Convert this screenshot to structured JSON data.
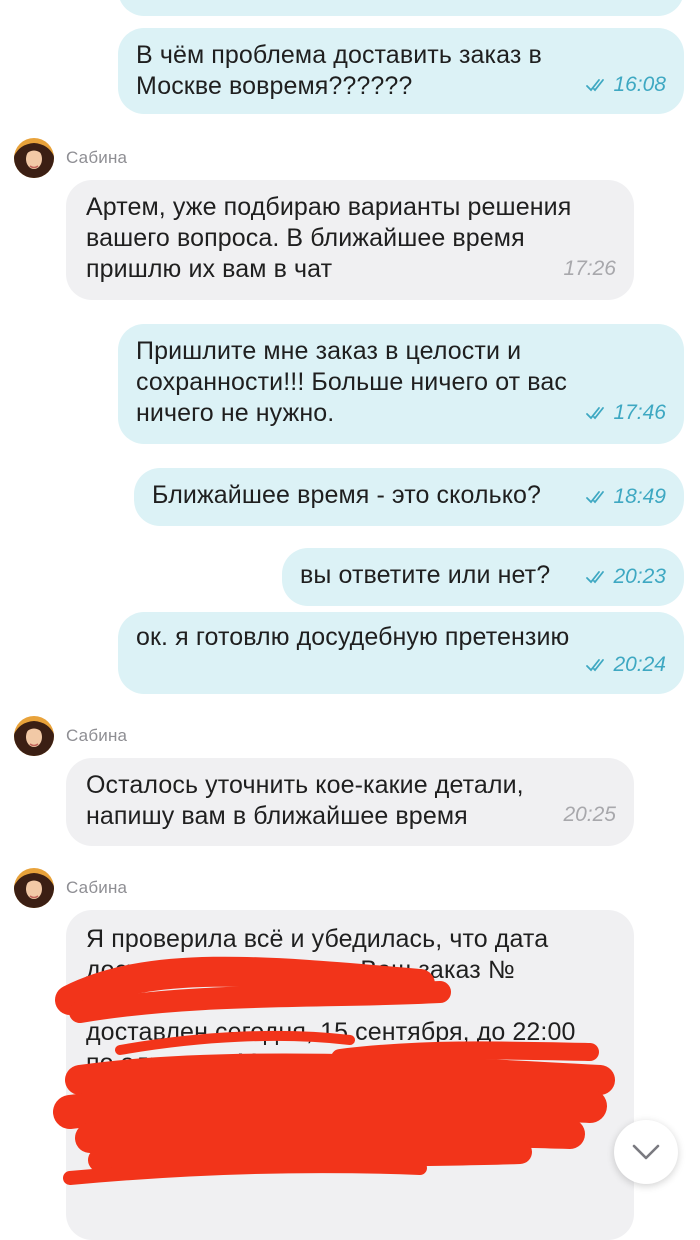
{
  "messages": [
    {
      "direction": "out",
      "text": "В чём проблема доставить заказ в\nМоскве вовремя??????",
      "time": "16:08",
      "status_icon": "double-check-icon"
    },
    {
      "direction": "in",
      "sender": "Сабина",
      "text": "Артем, уже подбираю варианты решения\nвашего вопроса. В ближайшее время\nпришлю их вам в чат",
      "time": "17:26"
    },
    {
      "direction": "out",
      "text": "Пришлите мне заказ в целости и\nсохранности!!! Больше ничего от вас\nничего не нужно.",
      "time": "17:46",
      "status_icon": "double-check-icon"
    },
    {
      "direction": "out",
      "text": "Ближайшее время - это сколько?",
      "time": "18:49",
      "status_icon": "double-check-icon"
    },
    {
      "direction": "out",
      "text": "вы ответите или нет?",
      "time": "20:23",
      "status_icon": "double-check-icon"
    },
    {
      "direction": "out",
      "text": "ок. я готовлю досудебную претензию",
      "time": "20:24",
      "status_icon": "double-check-icon"
    },
    {
      "direction": "in",
      "sender": "Сабина",
      "text": "Осталось уточнить кое-какие детали,\nнапишу вам в ближайшее время",
      "time": "20:25"
    },
    {
      "direction": "in",
      "sender": "Сабина",
      "text": "Я проверила всё и убедилась, что дата\nдоставки не менялась. Ваш заказ №\n                                       м будет\nдоставлен сегодня, 15 сентября, до 22:00\nпо адресу: г. Москва,"
    }
  ],
  "scroll_button": {
    "icon": "chevron-down-icon"
  },
  "colors": {
    "outgoing_bubble": "#dcf2f6",
    "incoming_bubble": "#f0f0f2",
    "outgoing_time": "#3ea8c2",
    "incoming_time": "#a8a8ac",
    "redaction": "#f2341a"
  }
}
